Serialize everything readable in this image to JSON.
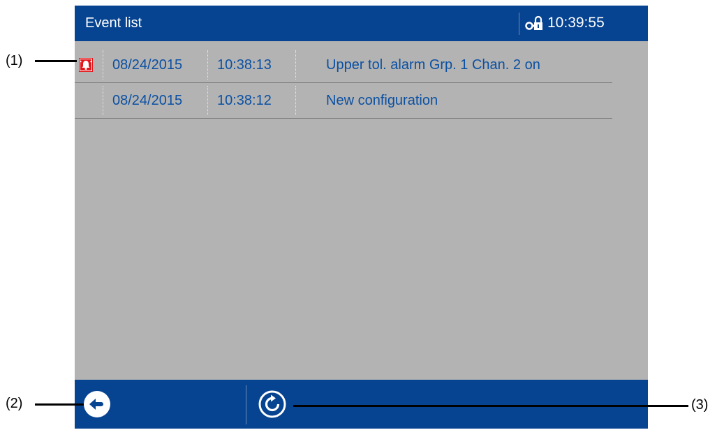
{
  "header": {
    "title": "Event list",
    "clock": "10:39:55",
    "lock_icon": "key-lock-icon"
  },
  "events": [
    {
      "icon": "alarm-bell-icon",
      "date": "08/24/2015",
      "time": "10:38:13",
      "text": "Upper tol. alarm Grp. 1 Chan. 2 on"
    },
    {
      "icon": "",
      "date": "08/24/2015",
      "time": "10:38:12",
      "text": "New configuration"
    }
  ],
  "footer": {
    "back_icon": "back-arrow-icon",
    "refresh_icon": "refresh-icon"
  },
  "callouts": [
    "(1)",
    "(2)",
    "(3)"
  ],
  "colors": {
    "header_bg": "#064390",
    "screen_bg": "#b3b3b3",
    "text_blue": "#0b50a2",
    "alarm_red": "#e3161b"
  }
}
